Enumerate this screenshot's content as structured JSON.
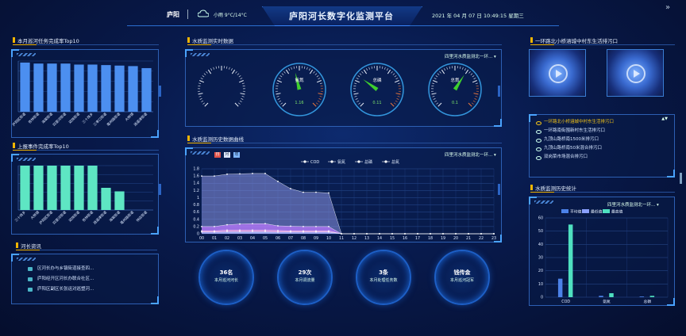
{
  "header": {
    "location": "庐阳",
    "weather": "小雨  9°C/14°C",
    "title": "庐阳河长数字化监测平台",
    "datetime": "2021 年 04 月 07 日 10:49:15 星期三"
  },
  "river_completion": {
    "title": "本月巡河任务完成率Top10",
    "categories": [
      "庐阳区街道",
      "杏林街道",
      "海棠街道",
      "四里河街道",
      "双岗街道",
      "三十岗乡",
      "三孝口街道",
      "亳州路街道",
      "大杨镇",
      "逍遥津街道"
    ],
    "values": [
      97,
      95,
      95,
      95,
      93,
      93,
      92,
      91,
      90,
      86
    ],
    "ylim": [
      0,
      100
    ],
    "color": "#4c8ff0"
  },
  "event_completion": {
    "title": "上报事件完成率Top10",
    "categories": [
      "三十岗乡",
      "大杨镇",
      "庐阳区街道",
      "四里河街道",
      "双岗街道",
      "杏林街道",
      "逍遥津街道",
      "海棠街道",
      "亳州路街道",
      "林店街道"
    ],
    "values": [
      100,
      100,
      100,
      100,
      100,
      100,
      50,
      42,
      0,
      0
    ],
    "ylim": [
      0,
      100
    ],
    "color": "#5ee6c3"
  },
  "news": {
    "title": "河长资讯",
    "items": [
      "区河长办与乡镇街道接查四...",
      "庐阳经开区河长办联合社区...",
      "庐阳区副区长张运对巡塑河..."
    ]
  },
  "realtime": {
    "title": "水质监测实时数据",
    "station": "四里河水质监测北一环...",
    "gauges": [
      {
        "name": "",
        "value": "",
        "fraction": 0.0,
        "color": "#e0e0e0"
      },
      {
        "name": "氨氮",
        "value": "1.16",
        "fraction": 0.45,
        "color": "#3ecf2e"
      },
      {
        "name": "总磷",
        "value": "0.11",
        "fraction": 0.3,
        "color": "#3ecf2e"
      },
      {
        "name": "总氮",
        "value": "0.1",
        "fraction": 0.62,
        "color": "#3ecf2e"
      }
    ]
  },
  "history": {
    "title": "水质监测历史数据曲线",
    "station": "四里河水质监测北一环...",
    "toolbar": [
      "日",
      "月",
      "年"
    ]
  },
  "chart_data": [
    {
      "type": "area",
      "x": [
        "00",
        "01",
        "02",
        "03",
        "04",
        "05",
        "06",
        "07",
        "08",
        "09",
        "10",
        "11",
        "12",
        "13",
        "14",
        "15",
        "16",
        "17",
        "18",
        "19",
        "20",
        "21",
        "22",
        "23"
      ],
      "ylim": [
        0,
        1.8
      ],
      "yticks": [
        "0",
        "0.2",
        "0.4",
        "0.6",
        "0.8",
        "1",
        "1.2",
        "1.4",
        "1.6",
        "1.8"
      ],
      "series": [
        {
          "name": "COD",
          "color": "#8aa0ff",
          "values": [
            1.6,
            1.6,
            1.65,
            1.66,
            1.67,
            1.67,
            1.45,
            1.25,
            1.15,
            1.15,
            1.13,
            0,
            0,
            0,
            0,
            0,
            0,
            0,
            0,
            0,
            0,
            0,
            0,
            0
          ]
        },
        {
          "name": "氨氮",
          "color": "#c47cff",
          "values": [
            0.2,
            0.2,
            0.25,
            0.27,
            0.28,
            0.28,
            0.22,
            0.21,
            0.2,
            0.2,
            0.2,
            0,
            0,
            0,
            0,
            0,
            0,
            0,
            0,
            0,
            0,
            0,
            0,
            0
          ]
        },
        {
          "name": "总磷",
          "color": "#ff9ad7",
          "values": [
            0.08,
            0.08,
            0.1,
            0.1,
            0.1,
            0.1,
            0.09,
            0.08,
            0.08,
            0.08,
            0.08,
            0,
            0,
            0,
            0,
            0,
            0,
            0,
            0,
            0,
            0,
            0,
            0,
            0
          ]
        },
        {
          "name": "总氮",
          "color": "#7cc5ff",
          "values": [
            0.05,
            0.05,
            0.06,
            0.06,
            0.06,
            0.06,
            0.05,
            0.05,
            0.05,
            0.05,
            0.05,
            0,
            0,
            0,
            0,
            0,
            0,
            0,
            0,
            0,
            0,
            0,
            0,
            0
          ]
        }
      ]
    },
    {
      "type": "bar",
      "categories": [
        "COD",
        "氨氮",
        "总磷"
      ],
      "ylim": [
        0,
        60
      ],
      "yticks": [
        "0",
        "10",
        "20",
        "30",
        "40",
        "50",
        "60"
      ],
      "series": [
        {
          "name": "平均值",
          "color": "#4c82e8",
          "values": [
            14,
            1,
            0.5
          ]
        },
        {
          "name": "最低值",
          "color": "#8aa0ff",
          "values": [
            0,
            0,
            0
          ]
        },
        {
          "name": "最高值",
          "color": "#4fe0c0",
          "values": [
            55,
            3,
            1
          ]
        }
      ]
    }
  ],
  "stats": [
    {
      "value": "36名",
      "label": "本月巡河河长"
    },
    {
      "value": "29次",
      "label": "本月调流量"
    },
    {
      "value": "3条",
      "label": "本月处理任务数"
    },
    {
      "value": "钱传金",
      "label": "本月巡河冠军"
    }
  ],
  "video": {
    "title": "一环路北小桥涵城中村东生活排污口",
    "items": [
      "一环路北小桥涵城中村东生活排污口",
      "一环路南街围新村东生活排污口",
      "九顶山路桥南1500米排污口",
      "九顶山路桥南50米混合排污口",
      "双岗菜市场混合排污口"
    ]
  },
  "stats_panel": {
    "title": "水质监测历史统计",
    "station": "四里河水质监测北一环..."
  }
}
